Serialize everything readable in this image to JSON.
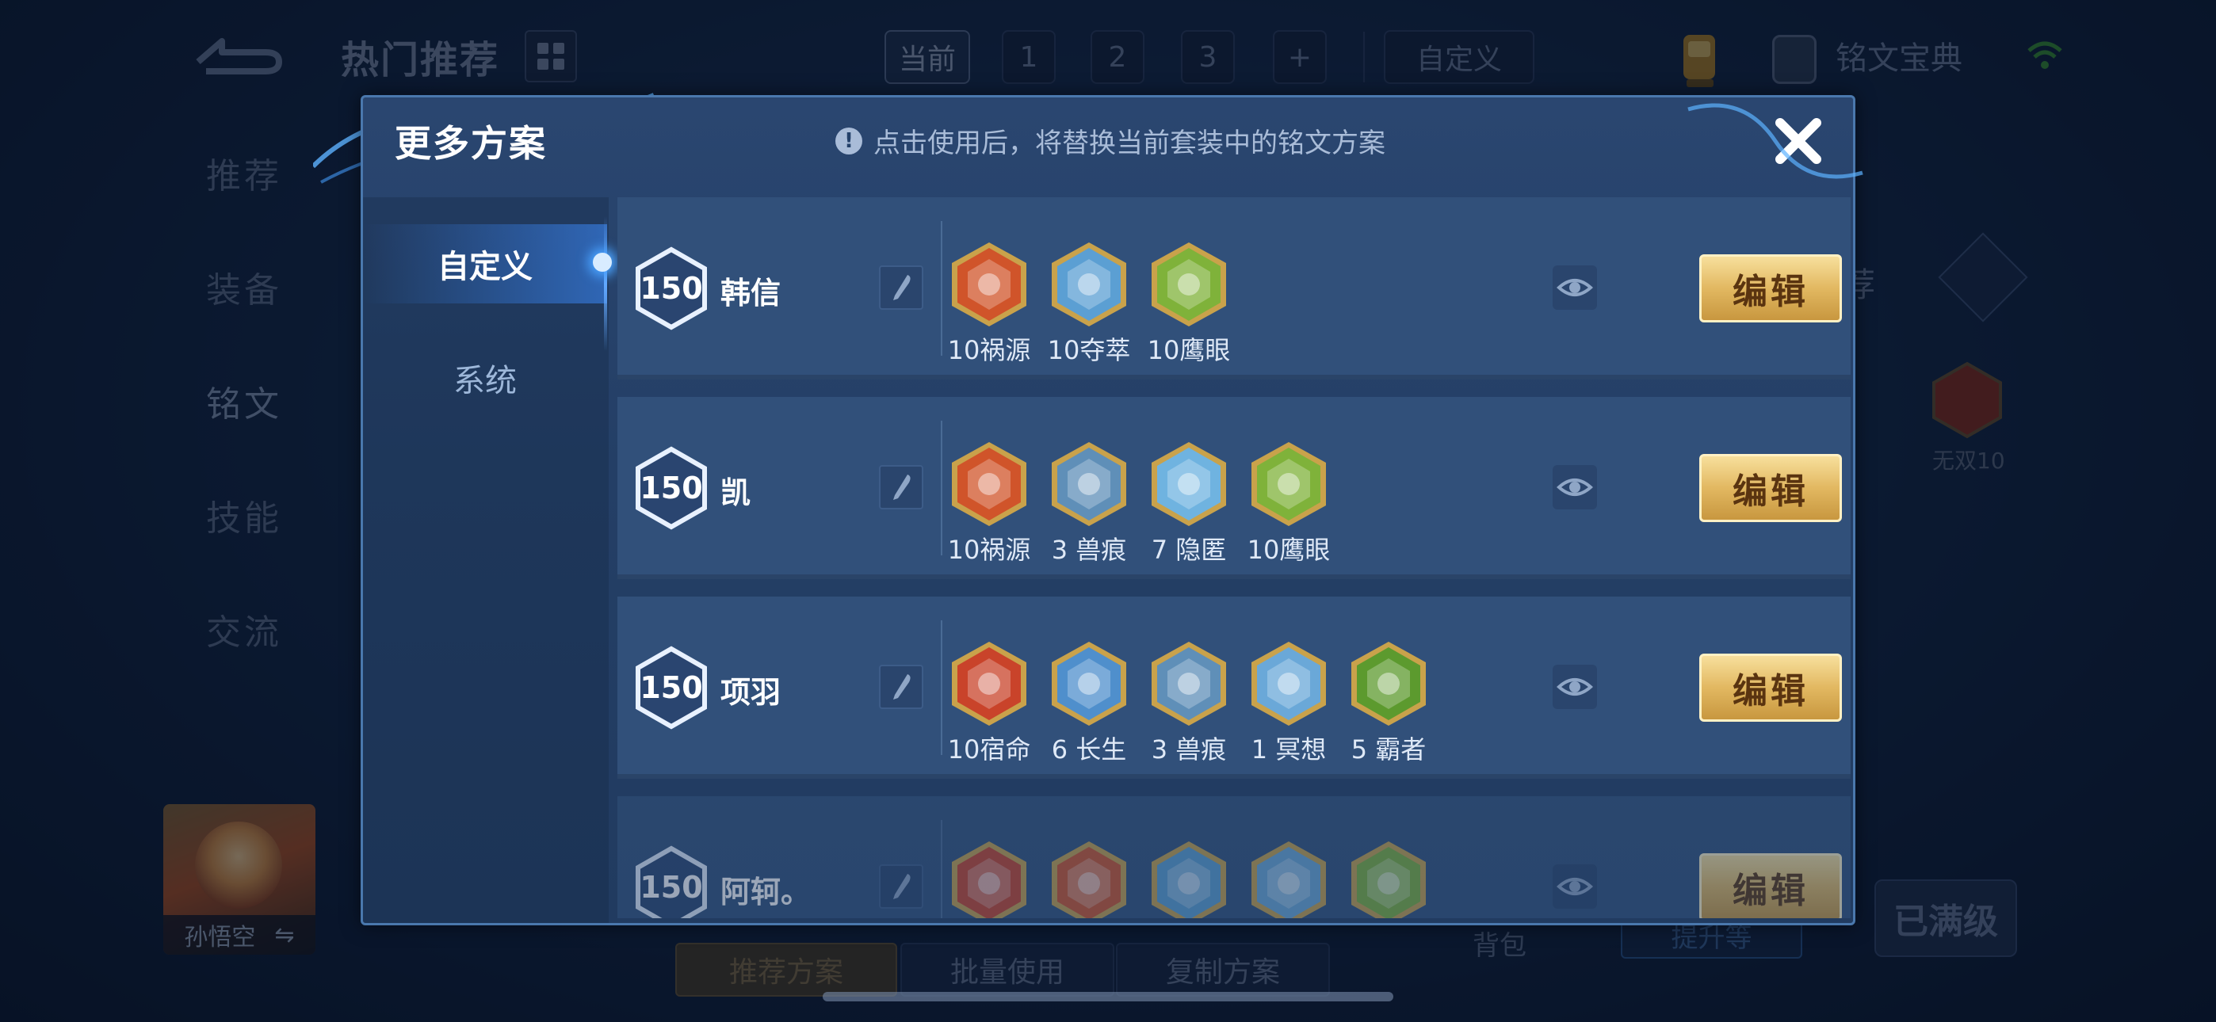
{
  "background": {
    "title": "热门推荐",
    "plan_tabs": [
      "当前",
      "1",
      "2",
      "3",
      "+"
    ],
    "custom_tab": "自定义",
    "codex_label": "铭文宝典",
    "side_nav": [
      "推荐",
      "装备",
      "铭文",
      "技能",
      "交流"
    ],
    "hero_name": "孙悟空",
    "hero_swap_symbol": "⇋",
    "bottom_buttons": [
      "推荐方案",
      "批量使用",
      "复制方案"
    ],
    "backpack": "背包",
    "upgrade": "提升等",
    "max_level": "已满级",
    "right_tab": "荐",
    "right_rune_label": "无双10"
  },
  "modal": {
    "title": "更多方案",
    "notice": "点击使用后，将替换当前套装中的铭文方案",
    "tabs": [
      {
        "label": "自定义",
        "active": true
      },
      {
        "label": "系统",
        "active": false
      }
    ],
    "edit_label": "编辑",
    "rows": [
      {
        "level": "150",
        "name": "韩信",
        "runes": [
          {
            "icon": "red-rune-icon",
            "color": "#d0542a",
            "label": "10祸源"
          },
          {
            "icon": "blue-rune-icon",
            "color": "#5b9fd3",
            "label": "10夺萃"
          },
          {
            "icon": "green-rune-icon",
            "color": "#7fb23a",
            "label": "10鹰眼"
          }
        ]
      },
      {
        "level": "150",
        "name": "凯",
        "runes": [
          {
            "icon": "red-rune-icon",
            "color": "#d0542a",
            "label": "10祸源"
          },
          {
            "icon": "blue-rune-icon",
            "color": "#5f8fb8",
            "label": "3 兽痕"
          },
          {
            "icon": "blue-rune-icon",
            "color": "#6fb3e0",
            "label": "7 隐匿"
          },
          {
            "icon": "green-rune-icon",
            "color": "#7fb23a",
            "label": "10鹰眼"
          }
        ]
      },
      {
        "level": "150",
        "name": "项羽",
        "runes": [
          {
            "icon": "red-rune-icon",
            "color": "#c9432a",
            "label": "10宿命"
          },
          {
            "icon": "blue-rune-icon",
            "color": "#4f8fcc",
            "label": "6 长生"
          },
          {
            "icon": "blue-rune-icon",
            "color": "#5f8fb8",
            "label": "3 兽痕"
          },
          {
            "icon": "blue-rune-icon",
            "color": "#6aa8d8",
            "label": "1 冥想"
          },
          {
            "icon": "green-rune-icon",
            "color": "#5c9a2e",
            "label": "5 霸者"
          }
        ]
      },
      {
        "level": "150",
        "name": "阿轲。",
        "runes": [
          {
            "icon": "red-rune-icon",
            "color": "#c9432a",
            "label": ""
          },
          {
            "icon": "red-rune-icon",
            "color": "#d0542a",
            "label": ""
          },
          {
            "icon": "blue-rune-icon",
            "color": "#5b9fd3",
            "label": ""
          },
          {
            "icon": "blue-rune-icon",
            "color": "#6aa8d8",
            "label": ""
          },
          {
            "icon": "green-rune-icon",
            "color": "#7fb23a",
            "label": ""
          }
        ]
      }
    ]
  }
}
